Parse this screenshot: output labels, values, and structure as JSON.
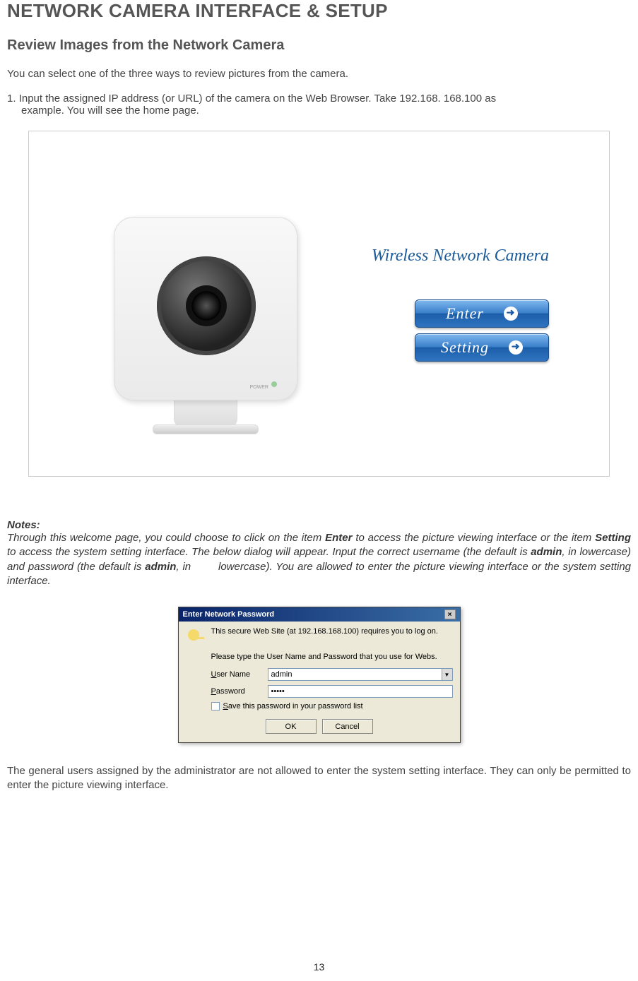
{
  "heading": "NETWORK CAMERA INTERFACE & SETUP",
  "subheading": "Review Images from the Network Camera",
  "intro": "You can select one of the three ways to review pictures from the camera.",
  "step1_prefix": "1. ",
  "step1_line1": "Input the assigned IP address (or URL) of the camera on the Web Browser. Take 192.168. 168.100 as",
  "step1_line2": "example. You will see the home page.",
  "homepage": {
    "title": "Wireless Network Camera",
    "enter_label": "Enter",
    "setting_label": "Setting",
    "power_label": "POWER"
  },
  "notes": {
    "heading": "Notes:",
    "text_before_enter": "Through this welcome page, you could choose to click on the item ",
    "enter": "Enter",
    "text_mid1": " to access the picture viewing interface or the item ",
    "setting": "Setting",
    "text_mid2": " to access the system setting interface. The below dialog will appear. Input the correct username (the default is ",
    "admin1": "admin",
    "text_mid3": ", in lowercase) and password (the default is ",
    "admin2": "admin",
    "text_mid4": ", in",
    "text_tail": "lowercase). You are allowed to enter the picture viewing interface or the system setting interface."
  },
  "dialog": {
    "title": "Enter Network Password",
    "msg1": "This secure Web Site (at 192.168.168.100) requires you to log on.",
    "msg2": "Please type the User Name and Password that you use for Webs.",
    "user_label_u": "U",
    "user_label_rest": "ser Name",
    "pass_label_u": "P",
    "pass_label_rest": "assword",
    "user_value": "admin",
    "pass_value": "•••••",
    "save_u": "S",
    "save_rest": "ave this password in your password list",
    "ok": "OK",
    "cancel": "Cancel"
  },
  "post_notes": "The general users assigned by the administrator are not allowed to enter the system setting interface. They can only be permitted to enter the picture viewing interface.",
  "page_number": "13"
}
